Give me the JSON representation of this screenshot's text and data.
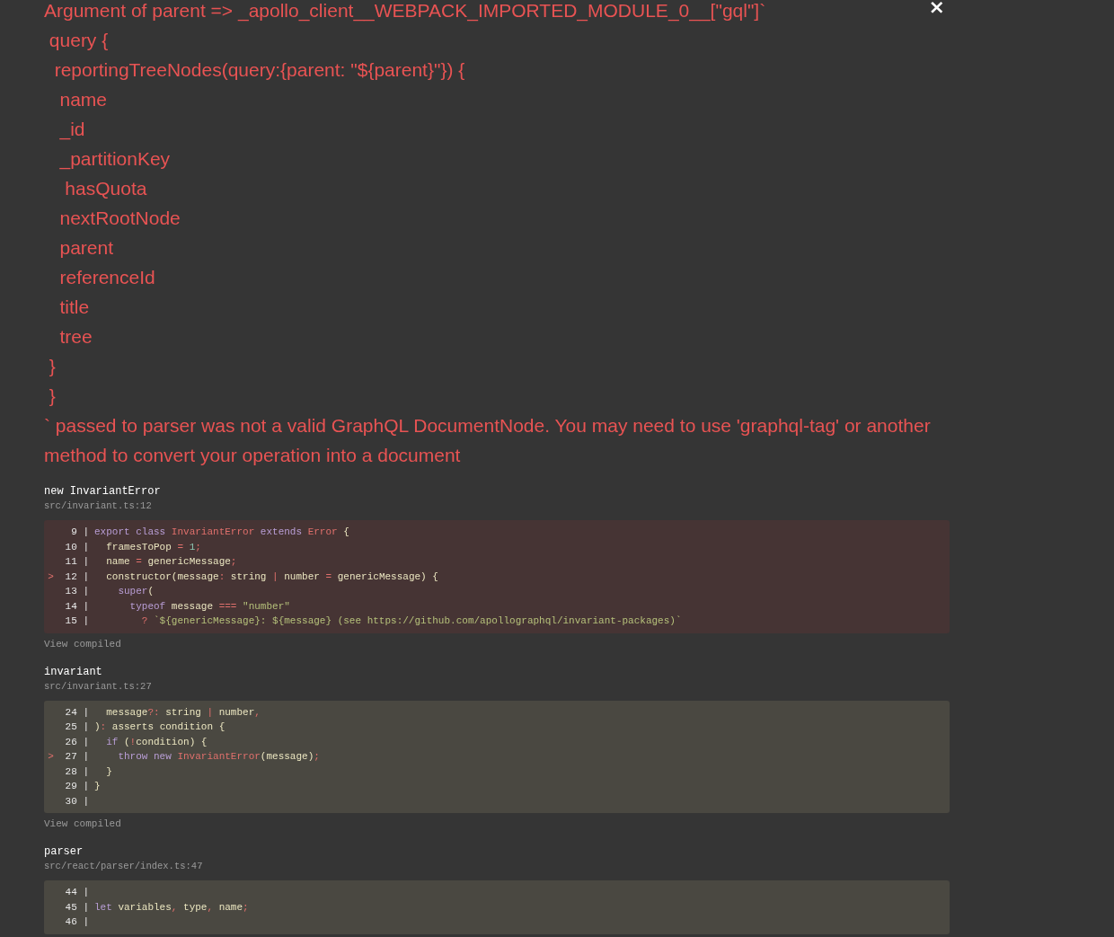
{
  "close_button": {
    "label": "×"
  },
  "message": [
    "Argument of parent => _apollo_client__WEBPACK_IMPORTED_MODULE_0__[\"gql\"]`",
    " query {",
    "  reportingTreeNodes(query:{parent: \"${parent}\"}) {",
    "   name",
    "   _id",
    "   _partitionKey",
    "    hasQuota",
    "   nextRootNode",
    "   parent",
    "   referenceId",
    "   title",
    "   tree",
    " }",
    " }",
    "` passed to parser was not a valid GraphQL DocumentNode. You may need to use 'graphql-tag' or another method to convert your operation into a document"
  ],
  "frames": [
    {
      "function": "new InvariantError",
      "location": "src/invariant.ts:12",
      "highlighted": true,
      "lines": [
        {
          "gutter": "9 |",
          "tokens": [
            {
              "kind": "keyword",
              "text": "export class "
            },
            {
              "kind": "red",
              "text": "InvariantError"
            },
            {
              "kind": "keyword",
              "text": " extends "
            },
            {
              "kind": "red",
              "text": "Error"
            },
            {
              "kind": "plain",
              "text": " {"
            }
          ]
        },
        {
          "gutter": "10 |",
          "tokens": [
            {
              "kind": "plain",
              "text": "  framesToPop "
            },
            {
              "kind": "red",
              "text": "="
            },
            {
              "kind": "number",
              "text": " 1"
            },
            {
              "kind": "red",
              "text": ";"
            }
          ]
        },
        {
          "gutter": "11 |",
          "tokens": [
            {
              "kind": "plain",
              "text": "  name "
            },
            {
              "kind": "red",
              "text": "="
            },
            {
              "kind": "plain",
              "text": " genericMessage"
            },
            {
              "kind": "red",
              "text": ";"
            }
          ]
        },
        {
          "marker": ">",
          "gutter": "12 |",
          "tokens": [
            {
              "kind": "plain",
              "text": "  constructor(message"
            },
            {
              "kind": "red",
              "text": ":"
            },
            {
              "kind": "plain",
              "text": " string "
            },
            {
              "kind": "red",
              "text": "|"
            },
            {
              "kind": "plain",
              "text": " number "
            },
            {
              "kind": "red",
              "text": "="
            },
            {
              "kind": "plain",
              "text": " genericMessage) {"
            }
          ]
        },
        {
          "gutter": "13 |",
          "tokens": [
            {
              "kind": "keyword",
              "text": "    super"
            },
            {
              "kind": "plain",
              "text": "("
            }
          ]
        },
        {
          "gutter": "14 |",
          "tokens": [
            {
              "kind": "keyword",
              "text": "      typeof"
            },
            {
              "kind": "plain",
              "text": " message "
            },
            {
              "kind": "red",
              "text": "==="
            },
            {
              "kind": "string",
              "text": " \"number\""
            }
          ]
        },
        {
          "gutter": "15 |",
          "tokens": [
            {
              "kind": "red",
              "text": "        ?"
            },
            {
              "kind": "string",
              "text": " `${genericMessage}: ${message} (see https://github.com/apollographql/invariant-packages)`"
            }
          ]
        }
      ],
      "compiled_link": "View compiled"
    },
    {
      "function": "invariant",
      "location": "src/invariant.ts:27",
      "highlighted": false,
      "lines": [
        {
          "gutter": "24 |",
          "tokens": [
            {
              "kind": "plain",
              "text": "  message"
            },
            {
              "kind": "red",
              "text": "?:"
            },
            {
              "kind": "plain",
              "text": " string "
            },
            {
              "kind": "red",
              "text": "|"
            },
            {
              "kind": "plain",
              "text": " number"
            },
            {
              "kind": "red",
              "text": ","
            }
          ]
        },
        {
          "gutter": "25 |",
          "tokens": [
            {
              "kind": "plain",
              "text": ")"
            },
            {
              "kind": "red",
              "text": ":"
            },
            {
              "kind": "plain",
              "text": " asserts condition {"
            }
          ]
        },
        {
          "gutter": "26 |",
          "tokens": [
            {
              "kind": "keyword",
              "text": "  if"
            },
            {
              "kind": "plain",
              "text": " ("
            },
            {
              "kind": "red",
              "text": "!"
            },
            {
              "kind": "plain",
              "text": "condition) {"
            }
          ]
        },
        {
          "marker": ">",
          "gutter": "27 |",
          "tokens": [
            {
              "kind": "keyword",
              "text": "    throw new "
            },
            {
              "kind": "red",
              "text": "InvariantError"
            },
            {
              "kind": "plain",
              "text": "(message)"
            },
            {
              "kind": "red",
              "text": ";"
            }
          ]
        },
        {
          "gutter": "28 |",
          "tokens": [
            {
              "kind": "plain",
              "text": "  }"
            }
          ]
        },
        {
          "gutter": "29 |",
          "tokens": [
            {
              "kind": "plain",
              "text": "}"
            }
          ]
        },
        {
          "gutter": "30 |"
        }
      ],
      "compiled_link": "View compiled"
    },
    {
      "function": "parser",
      "location": "src/react/parser/index.ts:47",
      "highlighted": false,
      "lines": [
        {
          "gutter": "44 |"
        },
        {
          "gutter": "45 |",
          "tokens": [
            {
              "kind": "keyword",
              "text": "let"
            },
            {
              "kind": "plain",
              "text": " variables"
            },
            {
              "kind": "red",
              "text": ","
            },
            {
              "kind": "plain",
              "text": " type"
            },
            {
              "kind": "red",
              "text": ","
            },
            {
              "kind": "plain",
              "text": " name"
            },
            {
              "kind": "red",
              "text": ";"
            }
          ]
        },
        {
          "gutter": "46 |"
        }
      ]
    }
  ]
}
